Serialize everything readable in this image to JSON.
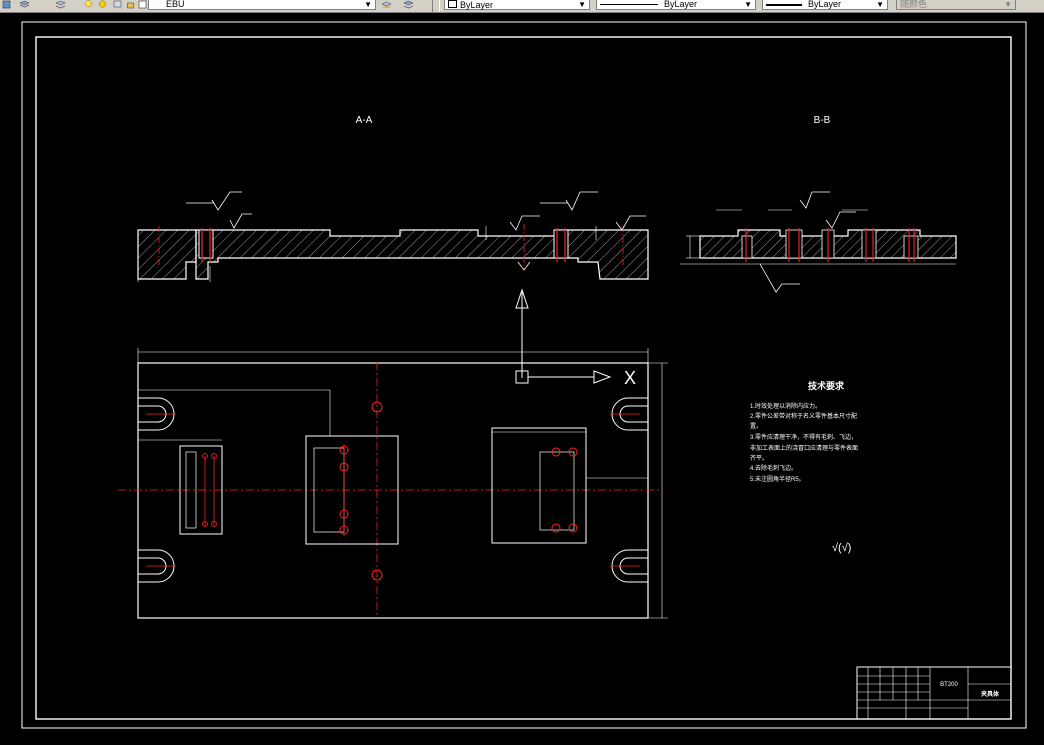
{
  "toolbar": {
    "layer_name": "EBU",
    "color_combo": "ByLayer",
    "linetype_combo": "ByLayer",
    "lineweight_combo": "ByLayer",
    "plotstyle_combo": "随颜色"
  },
  "drawing": {
    "section_aa_title": "A-A",
    "section_bb_title": "B-B",
    "axis_x_label": "X",
    "tech_title": "技术要求",
    "tech_lines": [
      "1.时效处理以消除内应力。",
      "2.零件公差带对称于名义零件基本尺寸配",
      "置。",
      "3.零件应清理干净，不得有毛刺、飞边，",
      "非加工表面上的浇冒口应清理与零件表面",
      "齐平。",
      "4.去除毛刺飞边。",
      "5.未注圆角半径R5。"
    ],
    "title_block_code": "BT200",
    "title_block_name": "夹具体",
    "roughness_note": "√(√)"
  },
  "colors": {
    "background": "#000000",
    "geometry": "#ffffff",
    "centerline": "#ff0000",
    "toolbar": "#d4d0c8"
  }
}
